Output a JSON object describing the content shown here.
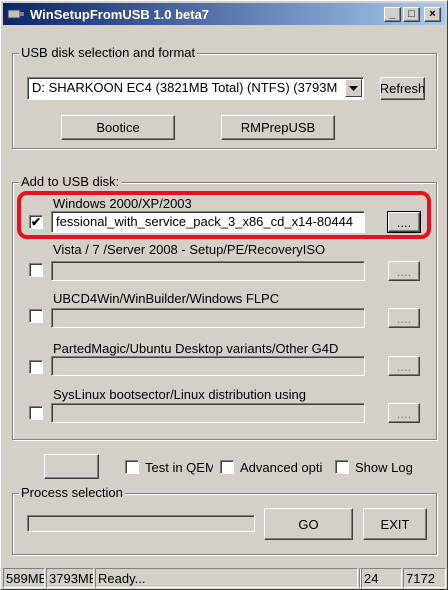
{
  "window": {
    "title": "WinSetupFromUSB 1.0 beta7"
  },
  "titlebar_buttons": {
    "minimize": "_",
    "maximize": "□",
    "close": "×"
  },
  "usb_group": {
    "title": "USB disk selection and format",
    "disk_select": "D: SHARKOON EC4 (3821MB Total) (NTFS) (3793M",
    "refresh_label": "Refresh",
    "bootice_label": "Bootice",
    "rmprepusb_label": "RMPrepUSB"
  },
  "add_group": {
    "title": "Add to USB disk:",
    "sources": [
      {
        "label": "Windows 2000/XP/2003",
        "checked": true,
        "path": "fessional_with_service_pack_3_x86_cd_x14-80444",
        "browse": "...."
      },
      {
        "label": "Vista / 7 /Server 2008 - Setup/PE/RecoveryISO",
        "checked": false,
        "path": "",
        "browse": "...."
      },
      {
        "label": "UBCD4Win/WinBuilder/Windows FLPC",
        "checked": false,
        "path": "",
        "browse": "...."
      },
      {
        "label": "PartedMagic/Ubuntu Desktop variants/Other G4D",
        "checked": false,
        "path": "",
        "browse": "...."
      },
      {
        "label": "SysLinux bootsector/Linux distribution using",
        "checked": false,
        "path": "",
        "browse": "...."
      }
    ]
  },
  "options": {
    "test_qemu": {
      "label": "Test in QEM",
      "checked": false
    },
    "advanced": {
      "label": "Advanced opti",
      "checked": false
    },
    "show_log": {
      "label": "Show Log",
      "checked": false
    }
  },
  "process_group": {
    "title": "Process selection",
    "progress": 0,
    "go_label": "GO",
    "exit_label": "EXIT"
  },
  "statusbar": {
    "cells": [
      "589MB",
      "3793MB",
      "Ready...",
      "",
      "24",
      "7172"
    ]
  },
  "colors": {
    "highlight": "#e8101c",
    "titlebar_start": "#0a246a",
    "titlebar_end": "#a6caf0"
  }
}
